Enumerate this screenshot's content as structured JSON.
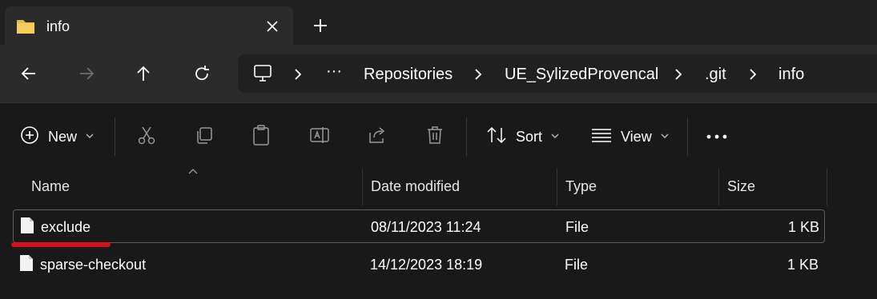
{
  "tab": {
    "title": "info",
    "icon": "folder-icon"
  },
  "address": {
    "overflow": "···",
    "crumbs": [
      "Repositories",
      "UE_SylizedProvencal",
      ".git",
      "info"
    ]
  },
  "toolbar": {
    "new_label": "New",
    "sort_label": "Sort",
    "view_label": "View"
  },
  "columns": {
    "name": "Name",
    "date": "Date modified",
    "type": "Type",
    "size": "Size"
  },
  "files": [
    {
      "name": "exclude",
      "date": "08/11/2023 11:24",
      "type": "File",
      "size": "1 KB"
    },
    {
      "name": "sparse-checkout",
      "date": "14/12/2023 18:19",
      "type": "File",
      "size": "1 KB"
    }
  ],
  "colors": {
    "background": "#191919",
    "annotation": "#d4101d"
  }
}
